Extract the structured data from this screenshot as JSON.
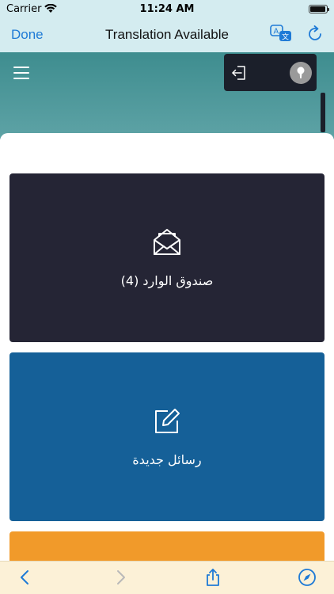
{
  "status_bar": {
    "carrier": "Carrier",
    "time": "11:24 AM",
    "battery_level": 0.95
  },
  "nav_bar": {
    "done_label": "Done",
    "title": "Translation Available",
    "icons": [
      "translate-icon",
      "reload-icon"
    ]
  },
  "header": {
    "icons": [
      "hamburger-menu-icon",
      "logout-icon",
      "avatar-icon"
    ]
  },
  "tiles": [
    {
      "label": "صندوق الوارد (4)",
      "icon": "open-envelope-icon",
      "color": "#252535"
    },
    {
      "label": "رسائل جديدة",
      "icon": "edit-icon",
      "color": "#156098"
    },
    {
      "label": "",
      "color": "#f19a2a"
    }
  ],
  "colors": {
    "accent": "#1e7ad6",
    "header_teal": "#3e8d8f",
    "toolbar_bg": "#fcf1d7"
  },
  "toolbar": {
    "icons": [
      "back-icon",
      "forward-icon",
      "share-icon",
      "compass-icon"
    ]
  }
}
